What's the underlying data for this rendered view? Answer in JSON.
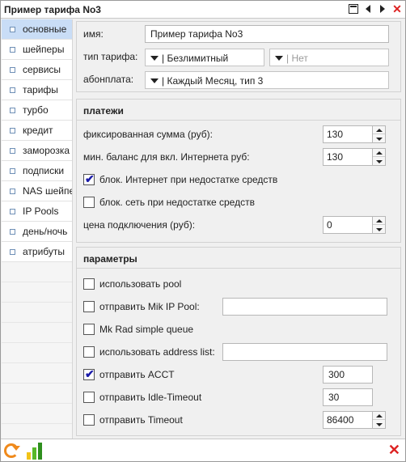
{
  "window": {
    "title": "Пример тарифа No3"
  },
  "sidebar": {
    "items": [
      {
        "label": "основные",
        "active": true
      },
      {
        "label": "шейперы",
        "active": false
      },
      {
        "label": "сервисы",
        "active": false
      },
      {
        "label": "тарифы",
        "active": false
      },
      {
        "label": "турбо",
        "active": false
      },
      {
        "label": "кредит",
        "active": false
      },
      {
        "label": "заморозка",
        "active": false
      },
      {
        "label": "подписки",
        "active": false
      },
      {
        "label": "NAS шейпер",
        "active": false
      },
      {
        "label": "IP Pools",
        "active": false
      },
      {
        "label": "день/ночь",
        "active": false
      },
      {
        "label": "атрибуты",
        "active": false
      }
    ]
  },
  "basic": {
    "name_label": "имя:",
    "name_value": "Пример тарифа No3",
    "type_label": "тип тарифа:",
    "type_value": "| Безлимитный",
    "type2_value": "| Нет",
    "fee_label": "абонплата:",
    "fee_value": "| Каждый Месяц, тип 3"
  },
  "payments": {
    "title": "платежи",
    "fixed_label": "фиксированная сумма (руб):",
    "fixed_value": "130",
    "minbal_label": "мин. баланс для вкл. Интернета руб:",
    "minbal_value": "130",
    "block_inet_label": "блок. Интернет при недостатке средств",
    "block_inet_checked": true,
    "block_net_label": "блок. сеть при недостатке средств",
    "block_net_checked": false,
    "connect_label": "цена подключения (руб):",
    "connect_value": "0"
  },
  "params": {
    "title": "параметры",
    "use_pool_label": "использовать pool",
    "use_pool_checked": false,
    "mik_pool_label": "отправить Mik IP Pool:",
    "mik_pool_checked": false,
    "mik_pool_value": "",
    "rad_queue_label": "Mk Rad simple queue",
    "rad_queue_checked": false,
    "addr_list_label": "использовать address list:",
    "addr_list_checked": false,
    "addr_list_value": "",
    "acct_label": "отправить ACCT",
    "acct_checked": true,
    "acct_value": "300",
    "idle_label": "отправить Idle-Timeout",
    "idle_checked": false,
    "idle_value": "30",
    "timeout_label": "отправить Timeout",
    "timeout_checked": false,
    "timeout_value": "86400"
  },
  "colors": {
    "accent": "#c9ddf6",
    "close": "#dd2222",
    "refresh": "#f08a1c",
    "chart_bars": [
      "#f2c318",
      "#58b82a",
      "#2f8f1e"
    ]
  },
  "icons": [
    "restore-icon",
    "prev-arrow-icon",
    "next-arrow-icon",
    "close-icon",
    "refresh-icon",
    "chart-icon",
    "close-icon"
  ]
}
